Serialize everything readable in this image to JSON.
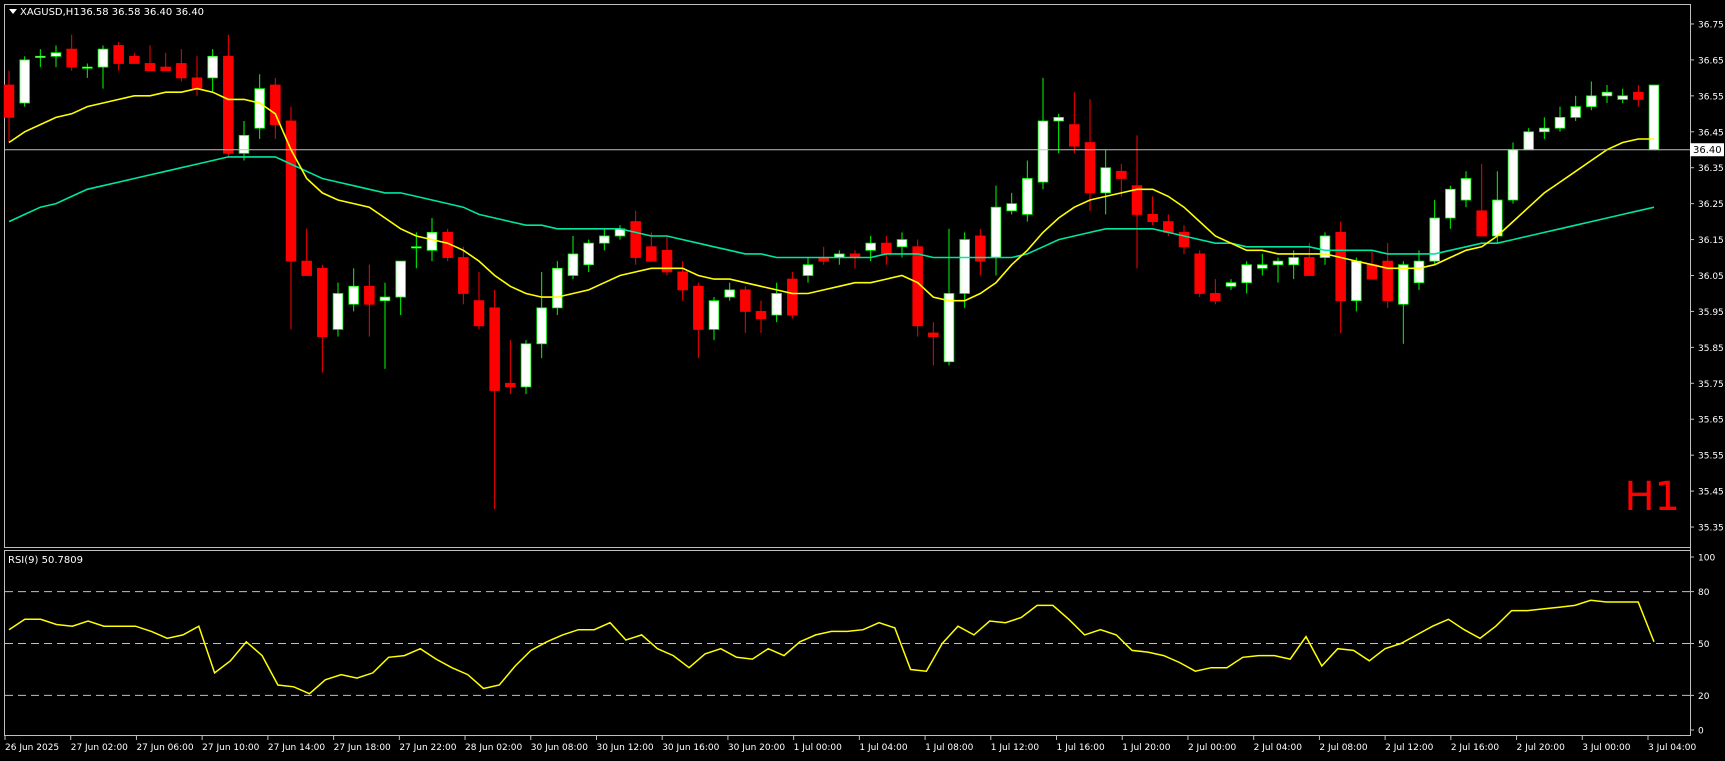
{
  "header": {
    "symbol": "XAGUSD,H1",
    "ohlc": "36.58 36.58 36.40 36.40"
  },
  "timeframe_badge": "H1",
  "current_price_label": "36.40",
  "colors": {
    "background": "#000000",
    "frame": "#c0c0c0",
    "axis_text": "#ffffff",
    "bull_body": "#ffffff",
    "bull_border": "#00ff00",
    "bear_body": "#ff0000",
    "wick_bull": "#00ff00",
    "wick_bear": "#ff0000",
    "ma_fast": "#ffff00",
    "ma_slow": "#00e5a0",
    "rsi_line": "#ffff00",
    "level_line": "#c0c0c0",
    "price_line": "#c0c0c0",
    "badge": "#ff0000"
  },
  "chart_data": [
    {
      "type": "candlestick",
      "title": "XAGUSD,H1",
      "ylim": [
        35.3,
        36.8
      ],
      "y_ticks": [
        "36.75",
        "36.65",
        "36.55",
        "36.45",
        "36.35",
        "36.25",
        "36.15",
        "36.05",
        "35.95",
        "35.85",
        "35.75",
        "35.65",
        "35.55",
        "35.45",
        "35.35"
      ],
      "x_tick_labels": [
        "26 Jun 2025",
        "27 Jun 02:00",
        "27 Jun 06:00",
        "27 Jun 10:00",
        "27 Jun 14:00",
        "27 Jun 18:00",
        "27 Jun 22:00",
        "28 Jun 02:00",
        "30 Jun 08:00",
        "30 Jun 12:00",
        "30 Jun 16:00",
        "30 Jun 20:00",
        "1 Jul 00:00",
        "1 Jul 04:00",
        "1 Jul 08:00",
        "1 Jul 12:00",
        "1 Jul 16:00",
        "1 Jul 20:00",
        "2 Jul 00:00",
        "2 Jul 04:00",
        "2 Jul 08:00",
        "2 Jul 12:00",
        "2 Jul 16:00",
        "2 Jul 20:00",
        "3 Jul 00:00",
        "3 Jul 04:00"
      ],
      "candles": [
        [
          36.58,
          36.62,
          36.42,
          36.49
        ],
        [
          36.53,
          36.66,
          36.52,
          36.65
        ],
        [
          36.66,
          36.68,
          36.63,
          36.66
        ],
        [
          36.66,
          36.69,
          36.63,
          36.67
        ],
        [
          36.68,
          36.72,
          36.62,
          36.63
        ],
        [
          36.63,
          36.64,
          36.6,
          36.63
        ],
        [
          36.63,
          36.69,
          36.57,
          36.68
        ],
        [
          36.69,
          36.7,
          36.62,
          36.64
        ],
        [
          36.66,
          36.67,
          36.64,
          36.64
        ],
        [
          36.64,
          36.69,
          36.63,
          36.62
        ],
        [
          36.63,
          36.67,
          36.62,
          36.62
        ],
        [
          36.64,
          36.68,
          36.59,
          36.6
        ],
        [
          36.6,
          36.66,
          36.55,
          36.57
        ],
        [
          36.6,
          36.68,
          36.56,
          36.66
        ],
        [
          36.66,
          36.72,
          36.38,
          36.39
        ],
        [
          36.39,
          36.48,
          36.37,
          36.44
        ],
        [
          36.46,
          36.61,
          36.43,
          36.57
        ],
        [
          36.58,
          36.6,
          36.43,
          36.47
        ],
        [
          36.48,
          36.52,
          35.9,
          36.09
        ],
        [
          36.09,
          36.18,
          36.05,
          36.05
        ],
        [
          36.07,
          36.08,
          35.78,
          35.88
        ],
        [
          35.9,
          36.03,
          35.88,
          36.0
        ],
        [
          35.97,
          36.07,
          35.95,
          36.02
        ],
        [
          36.02,
          36.08,
          35.88,
          35.97
        ],
        [
          35.98,
          36.03,
          35.79,
          35.99
        ],
        [
          35.99,
          36.08,
          35.94,
          36.09
        ],
        [
          36.13,
          36.17,
          36.07,
          36.13
        ],
        [
          36.12,
          36.21,
          36.09,
          36.17
        ],
        [
          36.17,
          36.18,
          36.09,
          36.1
        ],
        [
          36.1,
          36.13,
          35.97,
          36.0
        ],
        [
          35.98,
          36.06,
          35.9,
          35.91
        ],
        [
          35.96,
          36.01,
          35.4,
          35.73
        ],
        [
          35.75,
          35.87,
          35.72,
          35.74
        ],
        [
          35.74,
          35.87,
          35.72,
          35.86
        ],
        [
          35.86,
          36.06,
          35.82,
          35.96
        ],
        [
          35.96,
          36.09,
          35.94,
          36.07
        ],
        [
          36.05,
          36.16,
          36.04,
          36.11
        ],
        [
          36.08,
          36.15,
          36.06,
          36.14
        ],
        [
          36.14,
          36.18,
          36.12,
          36.16
        ],
        [
          36.16,
          36.19,
          36.15,
          36.18
        ],
        [
          36.2,
          36.23,
          36.08,
          36.1
        ],
        [
          36.13,
          36.17,
          36.1,
          36.09
        ],
        [
          36.12,
          36.16,
          36.05,
          36.06
        ],
        [
          36.06,
          36.09,
          35.98,
          36.01
        ],
        [
          36.02,
          36.03,
          35.82,
          35.9
        ],
        [
          35.9,
          35.99,
          35.87,
          35.98
        ],
        [
          35.99,
          36.03,
          35.98,
          36.01
        ],
        [
          36.01,
          36.02,
          35.89,
          35.95
        ],
        [
          35.95,
          35.98,
          35.89,
          35.93
        ],
        [
          35.94,
          36.03,
          35.92,
          36.0
        ],
        [
          36.04,
          36.06,
          35.93,
          35.94
        ],
        [
          36.05,
          36.1,
          36.03,
          36.08
        ],
        [
          36.1,
          36.13,
          36.08,
          36.09
        ],
        [
          36.1,
          36.12,
          36.08,
          36.11
        ],
        [
          36.11,
          36.12,
          36.07,
          36.1
        ],
        [
          36.12,
          36.16,
          36.09,
          36.14
        ],
        [
          36.14,
          36.16,
          36.08,
          36.11
        ],
        [
          36.13,
          36.17,
          36.1,
          36.15
        ],
        [
          36.13,
          36.15,
          35.88,
          35.91
        ],
        [
          35.89,
          35.92,
          35.8,
          35.88
        ],
        [
          35.81,
          36.18,
          35.8,
          36.0
        ],
        [
          36.0,
          36.17,
          35.96,
          36.15
        ],
        [
          36.16,
          36.18,
          36.05,
          36.09
        ],
        [
          36.1,
          36.3,
          36.05,
          36.24
        ],
        [
          36.23,
          36.28,
          36.22,
          36.25
        ],
        [
          36.22,
          36.37,
          36.2,
          36.32
        ],
        [
          36.31,
          36.6,
          36.29,
          36.48
        ],
        [
          36.48,
          36.5,
          36.39,
          36.49
        ],
        [
          36.47,
          36.56,
          36.39,
          36.41
        ],
        [
          36.42,
          36.54,
          36.23,
          36.28
        ],
        [
          36.28,
          36.4,
          36.22,
          36.35
        ],
        [
          36.34,
          36.36,
          36.27,
          36.32
        ],
        [
          36.3,
          36.44,
          36.07,
          36.22
        ],
        [
          36.22,
          36.27,
          36.19,
          36.2
        ],
        [
          36.2,
          36.22,
          36.16,
          36.17
        ],
        [
          36.17,
          36.19,
          36.11,
          36.13
        ],
        [
          36.11,
          36.12,
          35.99,
          36.0
        ],
        [
          36.0,
          36.04,
          35.97,
          35.98
        ],
        [
          36.02,
          36.04,
          36.01,
          36.03
        ],
        [
          36.03,
          36.09,
          36.0,
          36.08
        ],
        [
          36.07,
          36.11,
          36.05,
          36.08
        ],
        [
          36.08,
          36.1,
          36.03,
          36.09
        ],
        [
          36.08,
          36.12,
          36.04,
          36.1
        ],
        [
          36.1,
          36.14,
          36.06,
          36.05
        ],
        [
          36.1,
          36.17,
          36.08,
          36.16
        ],
        [
          36.17,
          36.2,
          35.89,
          35.98
        ],
        [
          35.98,
          36.1,
          35.95,
          36.09
        ],
        [
          36.08,
          36.12,
          36.06,
          36.04
        ],
        [
          36.09,
          36.14,
          35.96,
          35.98
        ],
        [
          35.97,
          36.09,
          35.86,
          36.08
        ],
        [
          36.03,
          36.12,
          36.01,
          36.09
        ],
        [
          36.09,
          36.26,
          36.08,
          36.21
        ],
        [
          36.21,
          36.3,
          36.18,
          36.29
        ],
        [
          36.26,
          36.34,
          36.24,
          36.32
        ],
        [
          36.23,
          36.36,
          36.22,
          36.16
        ],
        [
          36.16,
          36.34,
          36.14,
          36.26
        ],
        [
          36.26,
          36.42,
          36.25,
          36.4
        ],
        [
          36.4,
          36.46,
          36.4,
          36.45
        ],
        [
          36.45,
          36.49,
          36.43,
          36.46
        ],
        [
          36.46,
          36.52,
          36.45,
          36.49
        ],
        [
          36.49,
          36.55,
          36.48,
          36.52
        ],
        [
          36.52,
          36.59,
          36.51,
          36.55
        ],
        [
          36.55,
          36.58,
          36.53,
          36.56
        ],
        [
          36.54,
          36.57,
          36.53,
          36.55
        ],
        [
          36.56,
          36.58,
          36.52,
          36.54
        ],
        [
          36.4,
          36.58,
          36.4,
          36.58
        ]
      ],
      "ma_fast": [
        36.42,
        36.45,
        36.47,
        36.49,
        36.5,
        36.52,
        36.53,
        36.54,
        36.55,
        36.55,
        36.56,
        36.56,
        36.57,
        36.56,
        36.54,
        36.54,
        36.53,
        36.5,
        36.4,
        36.32,
        36.28,
        36.26,
        36.25,
        36.24,
        36.21,
        36.18,
        36.16,
        36.15,
        36.14,
        36.12,
        36.09,
        36.05,
        36.02,
        36.0,
        35.99,
        35.99,
        36.0,
        36.01,
        36.03,
        36.05,
        36.06,
        36.07,
        36.07,
        36.07,
        36.05,
        36.04,
        36.04,
        36.03,
        36.02,
        36.01,
        36.0,
        36.0,
        36.01,
        36.02,
        36.03,
        36.03,
        36.04,
        36.05,
        36.03,
        35.99,
        35.98,
        35.98,
        36.0,
        36.03,
        36.08,
        36.12,
        36.17,
        36.21,
        36.24,
        36.26,
        36.27,
        36.28,
        36.29,
        36.29,
        36.27,
        36.24,
        36.2,
        36.16,
        36.14,
        36.12,
        36.12,
        36.11,
        36.11,
        36.11,
        36.11,
        36.1,
        36.09,
        36.08,
        36.07,
        36.07,
        36.07,
        36.08,
        36.1,
        36.12,
        36.13,
        36.16,
        36.2,
        36.24,
        36.28,
        36.31,
        36.34,
        36.37,
        36.4,
        36.42,
        36.43,
        36.43
      ],
      "ma_slow": [
        36.2,
        36.22,
        36.24,
        36.25,
        36.27,
        36.29,
        36.3,
        36.31,
        36.32,
        36.33,
        36.34,
        36.35,
        36.36,
        36.37,
        36.38,
        36.38,
        36.38,
        36.38,
        36.36,
        36.34,
        36.32,
        36.31,
        36.3,
        36.29,
        36.28,
        36.28,
        36.27,
        36.26,
        36.25,
        36.24,
        36.22,
        36.21,
        36.2,
        36.19,
        36.19,
        36.18,
        36.18,
        36.18,
        36.18,
        36.18,
        36.17,
        36.16,
        36.16,
        36.15,
        36.14,
        36.13,
        36.12,
        36.11,
        36.11,
        36.1,
        36.1,
        36.1,
        36.1,
        36.1,
        36.1,
        36.1,
        36.11,
        36.11,
        36.11,
        36.1,
        36.1,
        36.1,
        36.1,
        36.1,
        36.1,
        36.11,
        36.13,
        36.15,
        36.16,
        36.17,
        36.18,
        36.18,
        36.18,
        36.18,
        36.17,
        36.16,
        36.15,
        36.14,
        36.14,
        36.13,
        36.13,
        36.13,
        36.13,
        36.13,
        36.12,
        36.12,
        36.12,
        36.12,
        36.11,
        36.11,
        36.11,
        36.11,
        36.12,
        36.13,
        36.14,
        36.14,
        36.15,
        36.16,
        36.17,
        36.18,
        36.19,
        36.2,
        36.21,
        36.22,
        36.23,
        36.24
      ]
    },
    {
      "type": "line",
      "title": "RSI(9) 50.7809",
      "ylim": [
        0,
        100
      ],
      "y_ticks": [
        "100",
        "80",
        "50",
        "20",
        "0"
      ],
      "levels": [
        80,
        50,
        20
      ],
      "values": [
        58,
        64,
        64,
        61,
        60,
        63,
        60,
        60,
        60,
        57,
        53,
        55,
        60,
        33,
        40,
        51,
        43,
        26,
        25,
        21,
        29,
        32,
        30,
        33,
        42,
        43,
        47,
        41,
        36,
        32,
        24,
        26,
        37,
        46,
        51,
        55,
        58,
        58,
        62,
        52,
        55,
        47,
        43,
        36,
        44,
        47,
        42,
        41,
        47,
        43,
        51,
        55,
        57,
        57,
        58,
        62,
        59,
        35,
        34,
        50,
        60,
        55,
        63,
        62,
        65,
        72,
        72,
        64,
        55,
        58,
        55,
        46,
        45,
        43,
        39,
        34,
        36,
        36,
        42,
        43,
        43,
        41,
        54,
        37,
        47,
        46,
        40,
        47,
        50,
        55,
        60,
        64,
        58,
        53,
        60,
        69,
        69,
        70,
        71,
        72,
        75,
        74,
        74,
        74,
        51
      ]
    }
  ]
}
